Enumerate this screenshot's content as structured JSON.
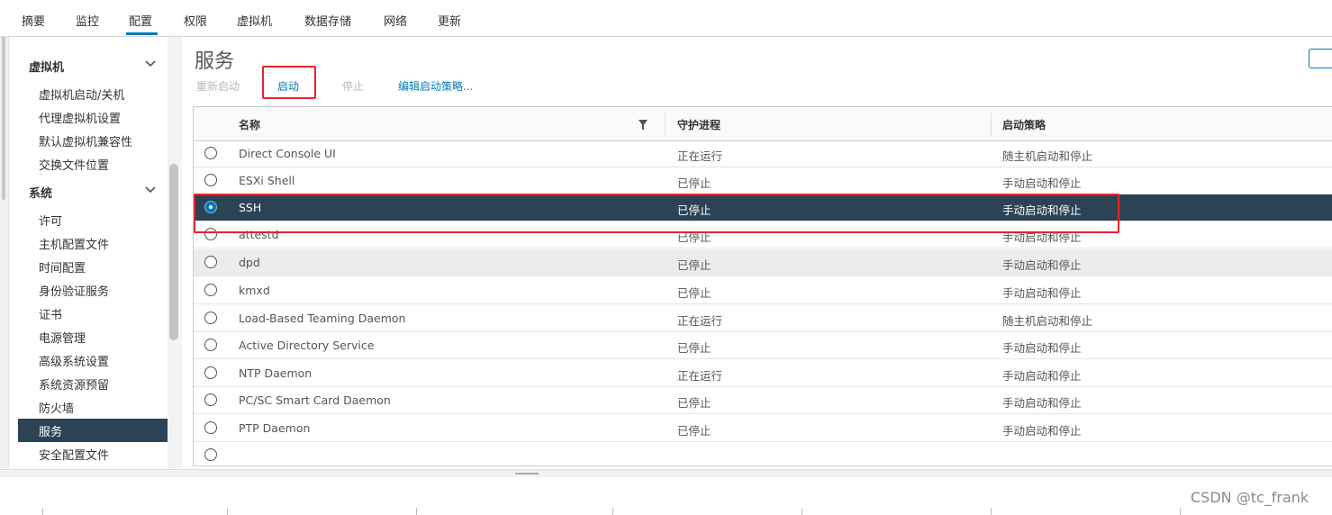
{
  "tabs": [
    "摘要",
    "监控",
    "配置",
    "权限",
    "虚拟机",
    "数据存储",
    "网络",
    "更新"
  ],
  "active_tab": "配置",
  "sidebar": {
    "sections": [
      {
        "label": "虚拟机",
        "items": [
          "虚拟机启动/关机",
          "代理虚拟机设置",
          "默认虚拟机兼容性",
          "交换文件位置"
        ]
      },
      {
        "label": "系统",
        "items": [
          "许可",
          "主机配置文件",
          "时间配置",
          "身份验证服务",
          "证书",
          "电源管理",
          "高级系统设置",
          "系统资源预留",
          "防火墙",
          "服务",
          "安全配置文件"
        ]
      }
    ],
    "active_item": "服务"
  },
  "main": {
    "title": "服务",
    "actions": {
      "restart": "重新启动",
      "start": "启动",
      "stop": "停止",
      "edit_policy": "编辑启动策略..."
    }
  },
  "table": {
    "columns": [
      "名称",
      "守护进程",
      "启动策略"
    ],
    "rows": [
      {
        "name": "Direct Console UI",
        "daemon": "正在运行",
        "policy": "随主机启动和停止"
      },
      {
        "name": "ESXi Shell",
        "daemon": "已停止",
        "policy": "手动启动和停止"
      },
      {
        "name": "SSH",
        "daemon": "已停止",
        "policy": "手动启动和停止"
      },
      {
        "name": "attestd",
        "daemon": "已停止",
        "policy": "手动启动和停止"
      },
      {
        "name": "dpd",
        "daemon": "已停止",
        "policy": "手动启动和停止"
      },
      {
        "name": "kmxd",
        "daemon": "已停止",
        "policy": "手动启动和停止"
      },
      {
        "name": "Load-Based Teaming Daemon",
        "daemon": "正在运行",
        "policy": "随主机启动和停止"
      },
      {
        "name": "Active Directory Service",
        "daemon": "已停止",
        "policy": "手动启动和停止"
      },
      {
        "name": "NTP Daemon",
        "daemon": "正在运行",
        "policy": "手动启动和停止"
      },
      {
        "name": "PC/SC Smart Card Daemon",
        "daemon": "已停止",
        "policy": "手动启动和停止"
      },
      {
        "name": "PTP Daemon",
        "daemon": "已停止",
        "policy": "手动启动和停止"
      }
    ],
    "selected_row": "SSH"
  },
  "watermark": "CSDN @tc_frank",
  "colors": {
    "accent": "#0079b8",
    "selected_bg": "#2c4355",
    "highlight_box": "#e8232a"
  }
}
